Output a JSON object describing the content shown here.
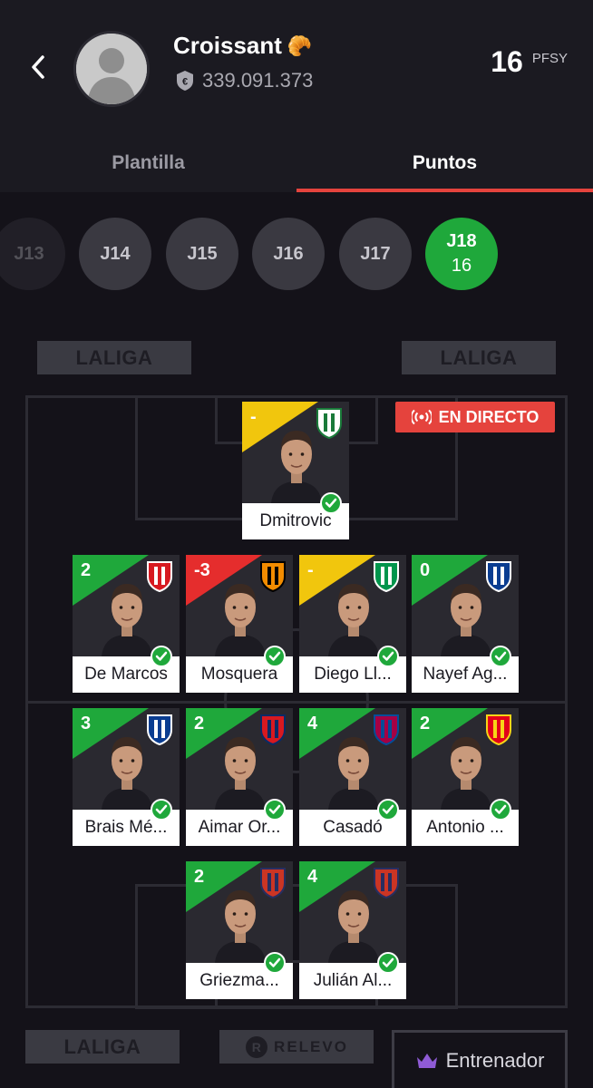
{
  "header": {
    "team_name": "Croissant",
    "team_emoji": "🥐",
    "team_value": "339.091.373",
    "points": "16",
    "points_unit": "PFSY"
  },
  "tabs": [
    {
      "label": "Plantilla",
      "active": false
    },
    {
      "label": "Puntos",
      "active": true
    }
  ],
  "rounds": [
    {
      "label": "J13",
      "points": ""
    },
    {
      "label": "J14",
      "points": ""
    },
    {
      "label": "J15",
      "points": ""
    },
    {
      "label": "J16",
      "points": ""
    },
    {
      "label": "J17",
      "points": ""
    },
    {
      "label": "J18",
      "points": "16"
    }
  ],
  "live_badge": "EN DIRECTO",
  "boards": {
    "top_left": "LALIGA",
    "top_right": "LALIGA",
    "bottom_left": "LALIGA",
    "bottom_mid": "RELEVO"
  },
  "coach_label": "Entrenador",
  "players": {
    "gk": [
      {
        "name": "Dmitrovic",
        "points": "-",
        "status": "yellow",
        "club": "Leganés",
        "crest_colors": [
          "#ffffff",
          "#1a7a3a"
        ]
      }
    ],
    "def": [
      {
        "name": "De Marcos",
        "points": "2",
        "status": "green",
        "club": "Athletic",
        "crest_colors": [
          "#d71920",
          "#ffffff"
        ]
      },
      {
        "name": "Mosquera",
        "points": "-3",
        "status": "red",
        "club": "Valencia",
        "crest_colors": [
          "#f28c00",
          "#000000"
        ]
      },
      {
        "name": "Diego Ll...",
        "points": "-",
        "status": "yellow",
        "club": "Betis",
        "crest_colors": [
          "#00954c",
          "#ffffff"
        ]
      },
      {
        "name": "Nayef Ag...",
        "points": "0",
        "status": "green",
        "club": "Real Sociedad",
        "crest_colors": [
          "#0a3d91",
          "#ffffff"
        ]
      }
    ],
    "mid": [
      {
        "name": "Brais Mé...",
        "points": "3",
        "status": "green",
        "club": "Real Sociedad",
        "crest_colors": [
          "#0a3d91",
          "#ffffff"
        ]
      },
      {
        "name": "Aimar Or...",
        "points": "2",
        "status": "green",
        "club": "Osasuna",
        "crest_colors": [
          "#d71920",
          "#0a2a66"
        ]
      },
      {
        "name": "Casadó",
        "points": "4",
        "status": "green",
        "club": "Barcelona",
        "crest_colors": [
          "#a50044",
          "#004d98"
        ]
      },
      {
        "name": "Antonio ...",
        "points": "2",
        "status": "green",
        "club": "Mallorca",
        "crest_colors": [
          "#e2001a",
          "#f7d417"
        ]
      }
    ],
    "fwd": [
      {
        "name": "Griezma...",
        "points": "2",
        "status": "green",
        "club": "Atlético",
        "crest_colors": [
          "#cb3524",
          "#272e61"
        ]
      },
      {
        "name": "Julián Al...",
        "points": "4",
        "status": "green",
        "club": "Atlético",
        "crest_colors": [
          "#cb3524",
          "#272e61"
        ]
      }
    ]
  },
  "colors": {
    "accent_red": "#e5433d",
    "green": "#1fa83b",
    "yellow": "#f1c60d",
    "red": "#e52d2d",
    "background": "#141219"
  }
}
